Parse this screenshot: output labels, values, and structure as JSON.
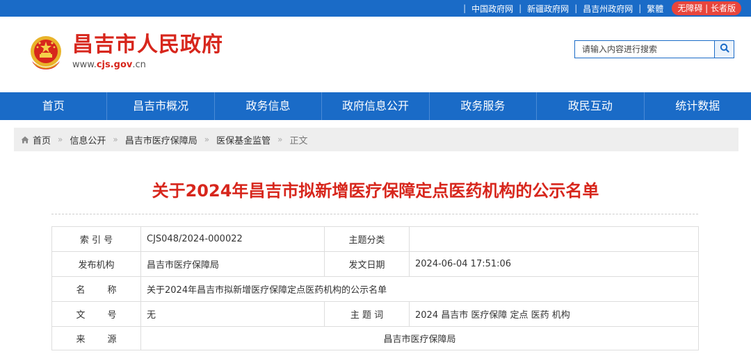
{
  "topbar": {
    "links": [
      "中国政府网",
      "新疆政府网",
      "昌吉州政府网",
      "繁體"
    ],
    "access_button": "无障碍 | 长者版"
  },
  "header": {
    "site_name": "昌吉市人民政府",
    "url_prefix": "www.",
    "url_highlight": "cjs.gov",
    "url_suffix": ".cn",
    "search_placeholder": "请输入内容进行搜索"
  },
  "nav": {
    "items": [
      "首页",
      "昌吉市概况",
      "政务信息",
      "政府信息公开",
      "政务服务",
      "政民互动",
      "统计数据"
    ]
  },
  "breadcrumb": {
    "items": [
      "首页",
      "信息公开",
      "昌吉市医疗保障局",
      "医保基金监管"
    ],
    "current": "正文",
    "separator": "»"
  },
  "article": {
    "title": "关于2024年昌吉市拟新增医疗保障定点医药机构的公示名单"
  },
  "info_table": {
    "index_label": "索 引 号",
    "index_value": "CJS048/2024-000022",
    "category_label": "主题分类",
    "category_value": "",
    "issuer_label": "发布机构",
    "issuer_value": "昌吉市医疗保障局",
    "date_label": "发文日期",
    "date_value": "2024-06-04 17:51:06",
    "name_label": "名称",
    "name_value": "关于2024年昌吉市拟新增医疗保障定点医药机构的公示名单",
    "docno_label": "文号",
    "docno_value": "无",
    "keywords_label": "主 题 词",
    "keywords_value": "2024 昌吉市 医疗保障 定点 医药 机构",
    "source_label": "来源",
    "source_value": "昌吉市医疗保障局"
  },
  "colors": {
    "primary_blue": "#1a6bc7",
    "title_red": "#d7261c",
    "access_red": "#e8453c",
    "breadcrumb_bg": "#eeeeee"
  },
  "icons": {
    "emblem": "national-emblem-icon",
    "search": "search-icon",
    "home": "home-icon"
  }
}
